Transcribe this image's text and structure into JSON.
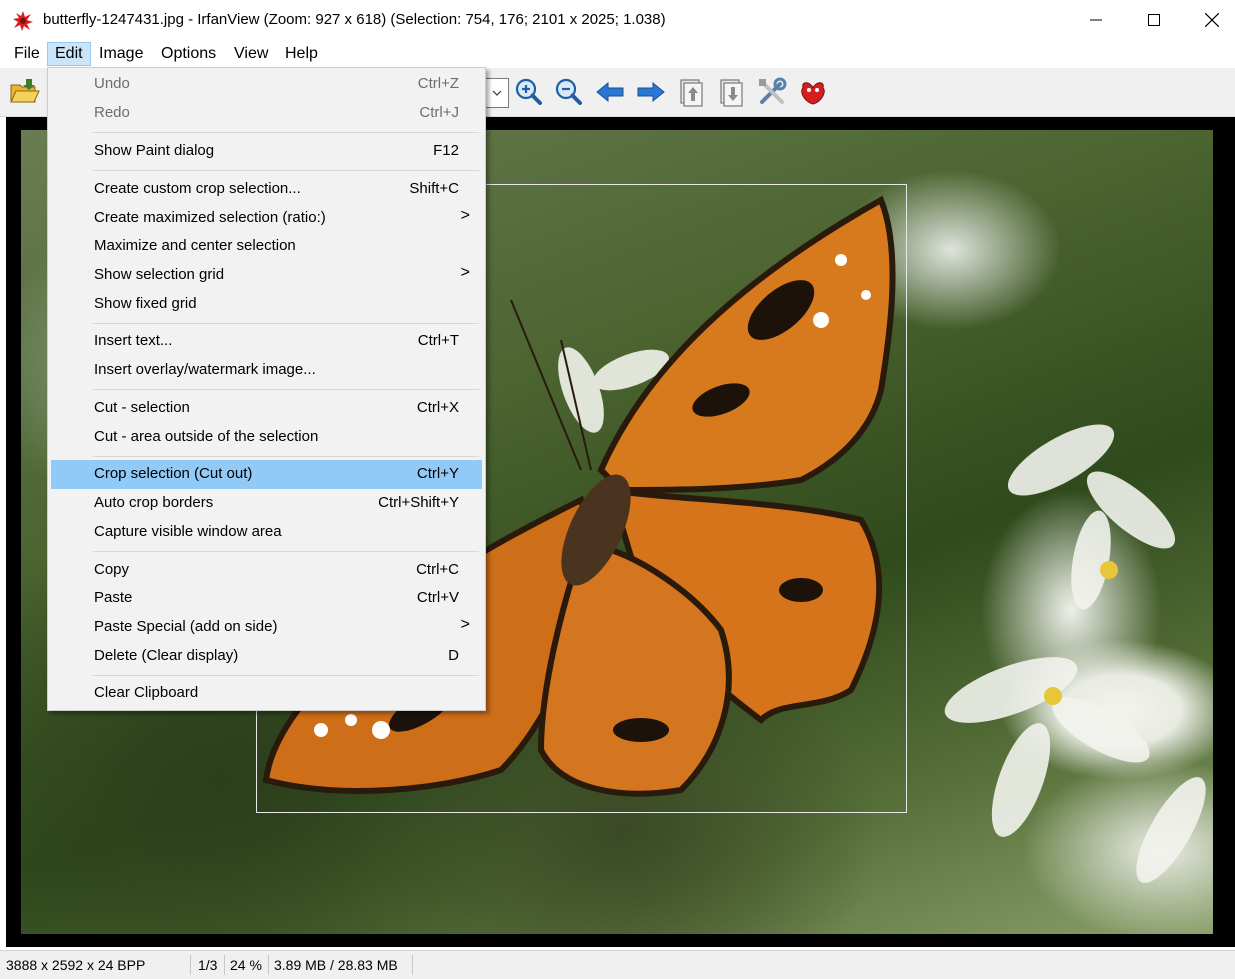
{
  "window": {
    "title": "butterfly-1247431.jpg - IrfanView (Zoom: 927 x 618) (Selection: 754, 176; 2101 x 2025; 1.038)"
  },
  "menubar": {
    "items": [
      "File",
      "Edit",
      "Image",
      "Options",
      "View",
      "Help"
    ],
    "active": "Edit"
  },
  "toolbar": {
    "icons": [
      "open-folder-icon",
      "zoom-in-icon",
      "zoom-out-icon",
      "previous-arrow-icon",
      "next-arrow-icon",
      "copy-page-icon",
      "paste-page-icon",
      "tools-icon",
      "irfanview-logo-icon"
    ]
  },
  "edit_menu": {
    "items": [
      {
        "label": "Undo",
        "shortcut": "Ctrl+Z",
        "disabled": true
      },
      {
        "label": "Redo",
        "shortcut": "Ctrl+J",
        "disabled": true
      },
      {
        "label": "Show Paint dialog",
        "shortcut": "F12"
      },
      {
        "label": "Create custom crop selection...",
        "shortcut": "Shift+C"
      },
      {
        "label": "Create maximized selection (ratio:)",
        "submenu": true
      },
      {
        "label": "Maximize and center selection"
      },
      {
        "label": "Show selection grid",
        "submenu": true
      },
      {
        "label": "Show fixed grid"
      },
      {
        "label": "Insert text...",
        "shortcut": "Ctrl+T"
      },
      {
        "label": "Insert overlay/watermark image..."
      },
      {
        "label": "Cut - selection",
        "shortcut": "Ctrl+X"
      },
      {
        "label": "Cut - area outside of the selection"
      },
      {
        "label": "Crop selection (Cut out)",
        "shortcut": "Ctrl+Y",
        "highlighted": true
      },
      {
        "label": "Auto crop borders",
        "shortcut": "Ctrl+Shift+Y"
      },
      {
        "label": "Capture visible window area"
      },
      {
        "label": "Copy",
        "shortcut": "Ctrl+C"
      },
      {
        "label": "Paste",
        "shortcut": "Ctrl+V"
      },
      {
        "label": "Paste Special (add on side)",
        "submenu": true
      },
      {
        "label": "Delete (Clear display)",
        "shortcut": "D"
      },
      {
        "label": "Clear Clipboard"
      }
    ],
    "submenu_arrow": ">"
  },
  "statusbar": {
    "dimensions": "3888 x 2592 x 24 BPP",
    "page": "1/3",
    "zoom": "24 %",
    "memory": "3.89 MB / 28.83 MB"
  },
  "colors": {
    "menu_highlight": "#91c9f7",
    "menubar_active": "#cce4f7",
    "disabled_text": "#6d6d6d"
  }
}
